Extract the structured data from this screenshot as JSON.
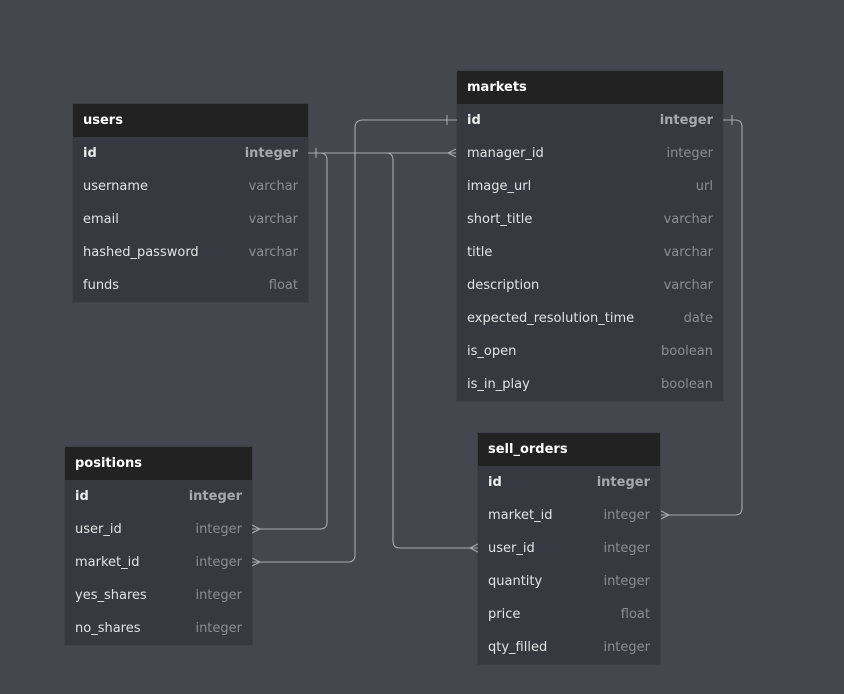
{
  "diagram": {
    "colors": {
      "background": "#46464f",
      "table_header": "#222222",
      "table_body": "#383840",
      "connector": "#a8a8b0"
    },
    "tables": {
      "users": {
        "name": "users",
        "fields": [
          {
            "name": "id",
            "type": "integer",
            "pk": true
          },
          {
            "name": "username",
            "type": "varchar"
          },
          {
            "name": "email",
            "type": "varchar"
          },
          {
            "name": "hashed_password",
            "type": "varchar"
          },
          {
            "name": "funds",
            "type": "float"
          }
        ]
      },
      "markets": {
        "name": "markets",
        "fields": [
          {
            "name": "id",
            "type": "integer",
            "pk": true
          },
          {
            "name": "manager_id",
            "type": "integer"
          },
          {
            "name": "image_url",
            "type": "url"
          },
          {
            "name": "short_title",
            "type": "varchar"
          },
          {
            "name": "title",
            "type": "varchar"
          },
          {
            "name": "description",
            "type": "varchar"
          },
          {
            "name": "expected_resolution_time",
            "type": "date"
          },
          {
            "name": "is_open",
            "type": "boolean"
          },
          {
            "name": "is_in_play",
            "type": "boolean"
          }
        ]
      },
      "positions": {
        "name": "positions",
        "fields": [
          {
            "name": "id",
            "type": "integer",
            "pk": true
          },
          {
            "name": "user_id",
            "type": "integer"
          },
          {
            "name": "market_id",
            "type": "integer"
          },
          {
            "name": "yes_shares",
            "type": "integer"
          },
          {
            "name": "no_shares",
            "type": "integer"
          }
        ]
      },
      "sell_orders": {
        "name": "sell_orders",
        "fields": [
          {
            "name": "id",
            "type": "integer",
            "pk": true
          },
          {
            "name": "market_id",
            "type": "integer"
          },
          {
            "name": "user_id",
            "type": "integer"
          },
          {
            "name": "quantity",
            "type": "integer"
          },
          {
            "name": "price",
            "type": "float"
          },
          {
            "name": "qty_filled",
            "type": "integer"
          }
        ]
      }
    },
    "relationships": [
      {
        "from": "users.id",
        "to": "markets.manager_id",
        "type": "one-to-many"
      },
      {
        "from": "users.id",
        "to": "positions.user_id",
        "type": "one-to-many"
      },
      {
        "from": "users.id",
        "to": "sell_orders.user_id",
        "type": "one-to-many"
      },
      {
        "from": "markets.id",
        "to": "positions.market_id",
        "type": "one-to-many"
      },
      {
        "from": "markets.id",
        "to": "sell_orders.market_id",
        "type": "one-to-many"
      }
    ]
  }
}
